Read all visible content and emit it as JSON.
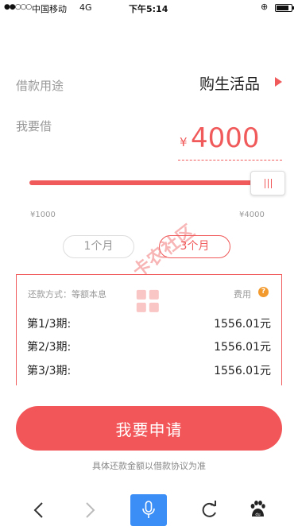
{
  "status_bar": {
    "signal": "●●○○○",
    "carrier": "中国移动",
    "network": "4G",
    "time": "下午5:14",
    "battery_level": 0.85
  },
  "loan": {
    "purpose_label": "借款用途",
    "purpose_value": "购生活品",
    "amount_label": "我要借",
    "currency_symbol": "¥",
    "amount": "4000",
    "slider_min_label": "¥1000",
    "slider_max_label": "¥4000",
    "slider_min": 1000,
    "slider_max": 4000,
    "slider_value": 4000,
    "terms": [
      {
        "label": "1个月",
        "selected": false
      },
      {
        "label": "3个月",
        "selected": true
      }
    ]
  },
  "watermark": {
    "text": "卡农社区"
  },
  "repayment": {
    "method_label": "还款方式：等额本息",
    "fee_label": "费用",
    "fee_icon": "?",
    "rows": [
      {
        "label": "第1/3期:",
        "amount": "1556.01元"
      },
      {
        "label": "第2/3期:",
        "amount": "1556.01元"
      },
      {
        "label": "第3/3期:",
        "amount": "1556.01元"
      }
    ]
  },
  "apply_button": "我要申请",
  "disclaimer": "具体还款金额以借款协议为准",
  "toolbar": {
    "icons": [
      "back-icon",
      "forward-icon",
      "microphone-icon",
      "refresh-icon",
      "baidu-paw-icon"
    ]
  },
  "colors": {
    "accent": "#f05a5a",
    "button": "#f25658",
    "fee_icon": "#f39a2e",
    "mic_button": "#3a8ef6",
    "muted_text": "#999999"
  }
}
